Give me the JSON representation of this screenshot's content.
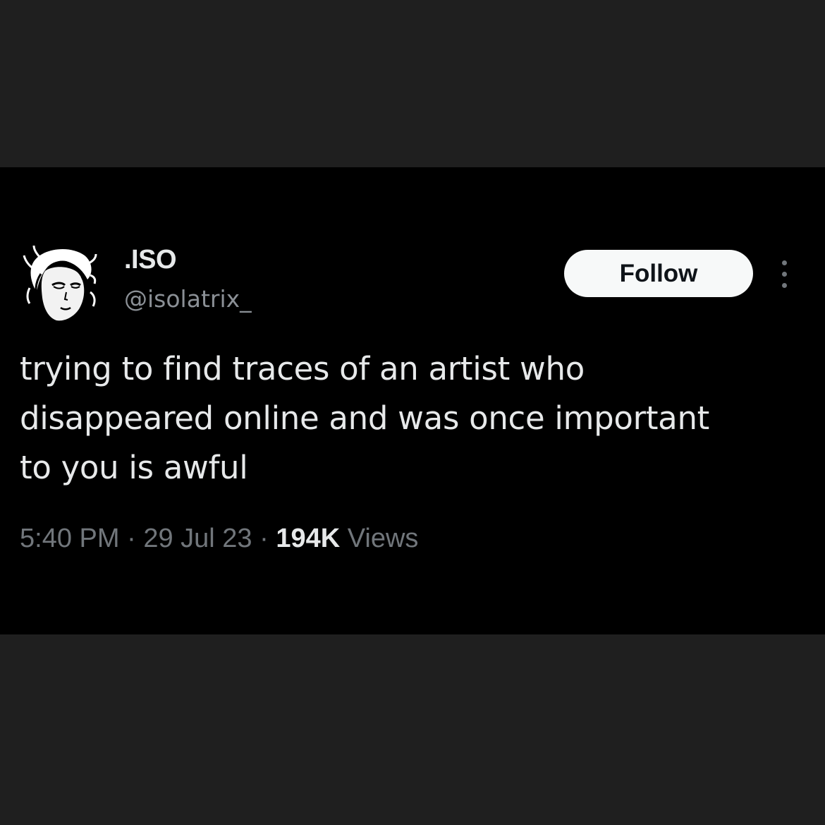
{
  "tweet": {
    "author": {
      "display_name": ".ISO",
      "handle": "@isolatrix_",
      "avatar_icon": "avatar-drawing-icon"
    },
    "follow_label": "Follow",
    "more_icon": "more-vertical-icon",
    "text_lines": [
      "trying to find traces of an artist who",
      "disappeared online and was once important",
      "to you is awful"
    ],
    "time": "5:40 PM",
    "separator": "·",
    "date": "29 Jul 23",
    "views_count": "194K",
    "views_label": "Views"
  },
  "colors": {
    "page_background": "#1f1f1f",
    "card_background": "#000000",
    "primary_text": "#e7e9ea",
    "secondary_text": "#71767b",
    "follow_button_bg": "#f7f9f9",
    "follow_button_text": "#0f1419"
  }
}
